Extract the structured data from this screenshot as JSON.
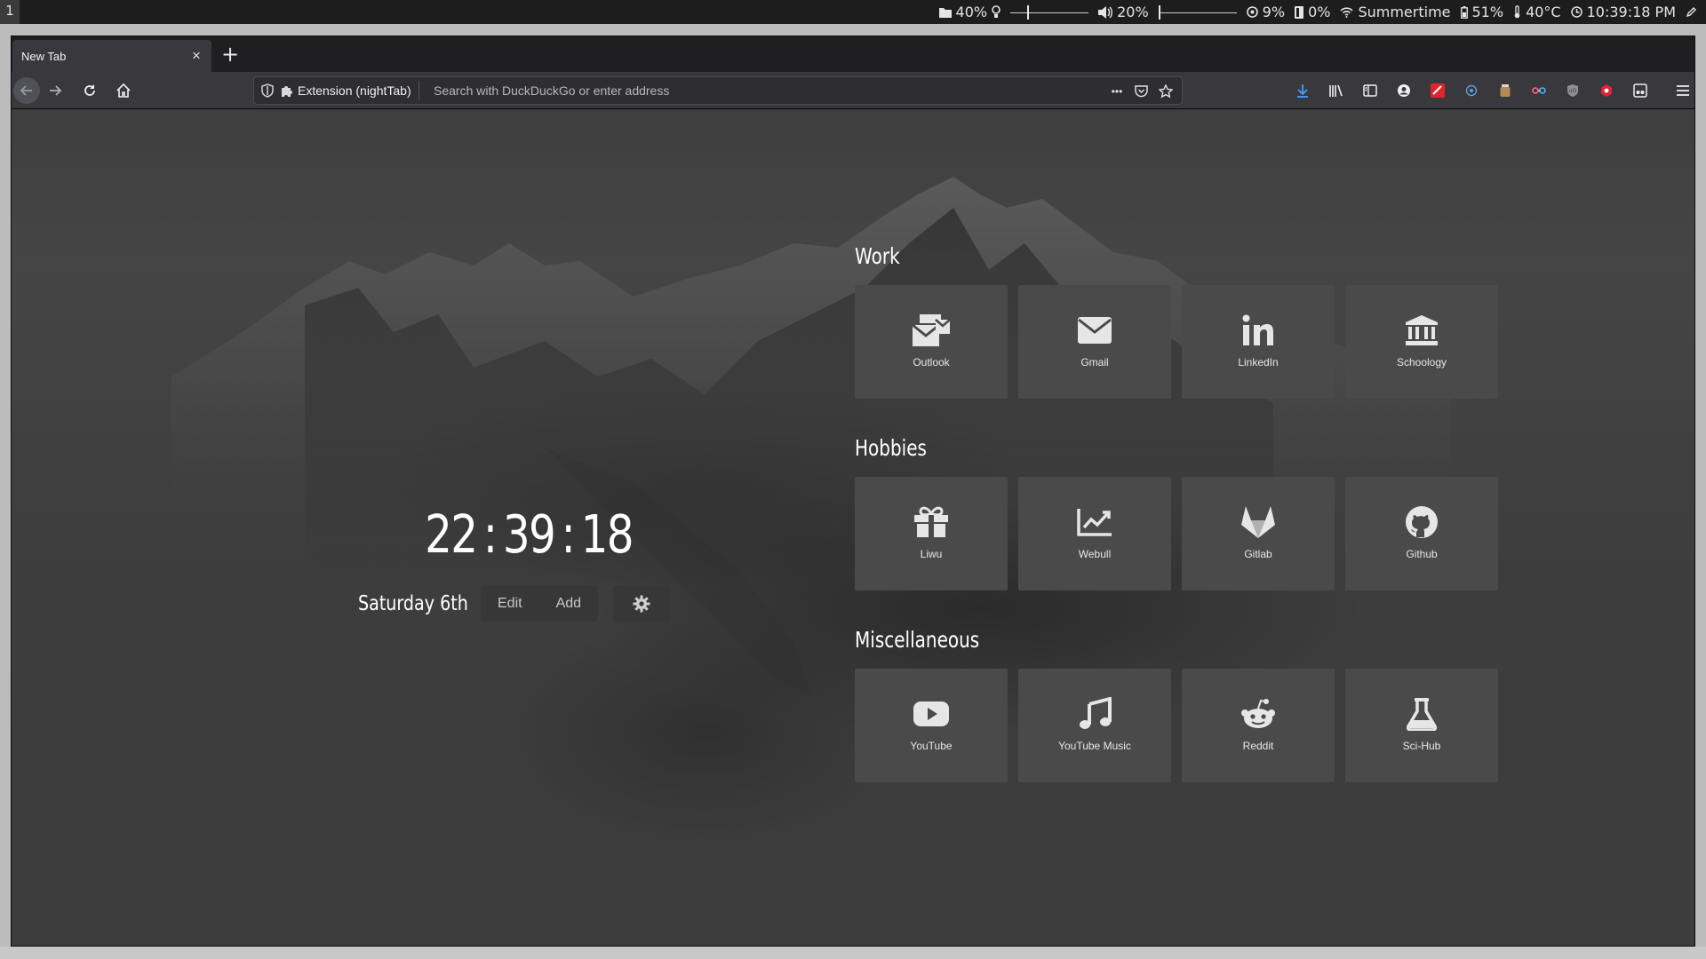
{
  "system_bar": {
    "workspace": "1",
    "brightness": "40%",
    "volume": "20%",
    "volume_level_fraction": 0.2,
    "brightness_level_fraction": 0.4,
    "cpu": "9%",
    "memory": "0%",
    "wifi": "Summertime",
    "battery": "51%",
    "temperature": "40°C",
    "clock": "10:39:18 PM"
  },
  "browser": {
    "tab_title": "New Tab",
    "tab_close": "×",
    "new_tab": "+",
    "url_identity": "Extension (nightTab)",
    "url_placeholder": "Search with DuckDuckGo or enter address",
    "page_actions": "•••"
  },
  "nighttab": {
    "clock": {
      "hours": "22",
      "minutes": "39",
      "seconds": "18",
      "separator": ":"
    },
    "date": "Saturday 6th",
    "controls": {
      "edit": "Edit",
      "add": "Add"
    },
    "groups": [
      {
        "title": "Work",
        "tiles": [
          {
            "label": "Outlook",
            "icon": "envelopes-icon"
          },
          {
            "label": "Gmail",
            "icon": "envelope-icon"
          },
          {
            "label": "LinkedIn",
            "icon": "linkedin-icon"
          },
          {
            "label": "Schoology",
            "icon": "university-icon"
          }
        ]
      },
      {
        "title": "Hobbies",
        "tiles": [
          {
            "label": "Liwu",
            "icon": "gift-icon"
          },
          {
            "label": "Webull",
            "icon": "chart-line-icon"
          },
          {
            "label": "Gitlab",
            "icon": "gitlab-icon"
          },
          {
            "label": "Github",
            "icon": "github-icon"
          }
        ]
      },
      {
        "title": "Miscellaneous",
        "tiles": [
          {
            "label": "YouTube",
            "icon": "youtube-icon"
          },
          {
            "label": "YouTube Music",
            "icon": "music-note-icon"
          },
          {
            "label": "Reddit",
            "icon": "reddit-icon"
          },
          {
            "label": "Sci-Hub",
            "icon": "flask-icon"
          }
        ]
      }
    ]
  },
  "colors": {
    "tile_bg": "#4a4a4a",
    "accent_download": "#45a1ff",
    "ext_red": "#e0242d"
  }
}
